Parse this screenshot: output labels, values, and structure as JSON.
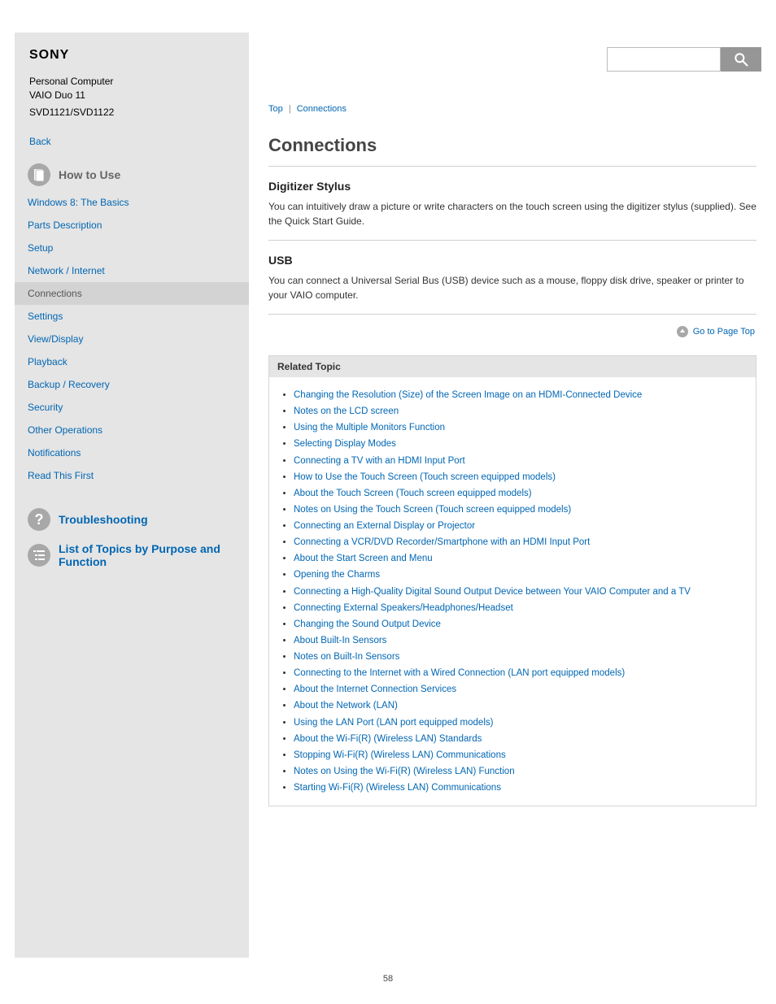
{
  "brand": "SONY",
  "product": {
    "line1": "Personal Computer",
    "line2": "VAIO Duo 11",
    "model": "SVD1121/SVD1122"
  },
  "backlink": "Back",
  "search": {
    "placeholder": ""
  },
  "sidebar": {
    "howto_title": "How to Use",
    "items": [
      "Windows 8: The Basics",
      "Parts Description",
      "Setup",
      "Network / Internet",
      "Connections",
      "Settings",
      "View/Display",
      "Playback",
      "Backup / Recovery",
      "Security",
      "Other Operations",
      "Notifications",
      "Read This First"
    ],
    "active_index": 4
  },
  "secondary_nav": {
    "troubleshooting": "Troubleshooting",
    "functions": "List of Topics by Purpose and Function"
  },
  "breadcrumb": {
    "parent": "Top",
    "current": "Connections"
  },
  "page_title": "Connections",
  "sections": [
    {
      "heading": "Digitizer Stylus",
      "body": "You can intuitively draw a picture or write characters on the touch screen using the digitizer stylus (supplied). See the Quick Start Guide."
    },
    {
      "heading": "USB",
      "body": "You can connect a Universal Serial Bus (USB) device such as a mouse, floppy disk drive, speaker or printer to your VAIO computer."
    }
  ],
  "gototop": "Go to Page Top",
  "related": {
    "header": "Related Topic",
    "items": [
      "Changing the Resolution (Size) of the Screen Image on an HDMI-Connected Device",
      "Notes on the LCD screen",
      "Using the Multiple Monitors Function",
      "Selecting Display Modes",
      "Connecting a TV with an HDMI Input Port",
      "How to Use the Touch Screen (Touch screen equipped models)",
      "About the Touch Screen (Touch screen equipped models)",
      "Notes on Using the Touch Screen (Touch screen equipped models)",
      "Connecting an External Display or Projector",
      "Connecting a VCR/DVD Recorder/Smartphone with an HDMI Input Port",
      "About the Start Screen and Menu",
      "Opening the Charms",
      "Connecting a High-Quality Digital Sound Output Device between Your VAIO Computer and a TV",
      "Connecting External Speakers/Headphones/Headset",
      "Changing the Sound Output Device",
      "About Built-In Sensors",
      "Notes on Built-In Sensors",
      "Connecting to the Internet with a Wired Connection (LAN port equipped models)",
      "About the Internet Connection Services",
      "About the Network (LAN)",
      "Using the LAN Port (LAN port equipped models)",
      "About the Wi-Fi(R) (Wireless LAN) Standards",
      "Stopping Wi-Fi(R) (Wireless LAN) Communications",
      "Notes on Using the Wi-Fi(R) (Wireless LAN) Function",
      "Starting Wi-Fi(R) (Wireless LAN) Communications"
    ]
  },
  "page_number": "58"
}
